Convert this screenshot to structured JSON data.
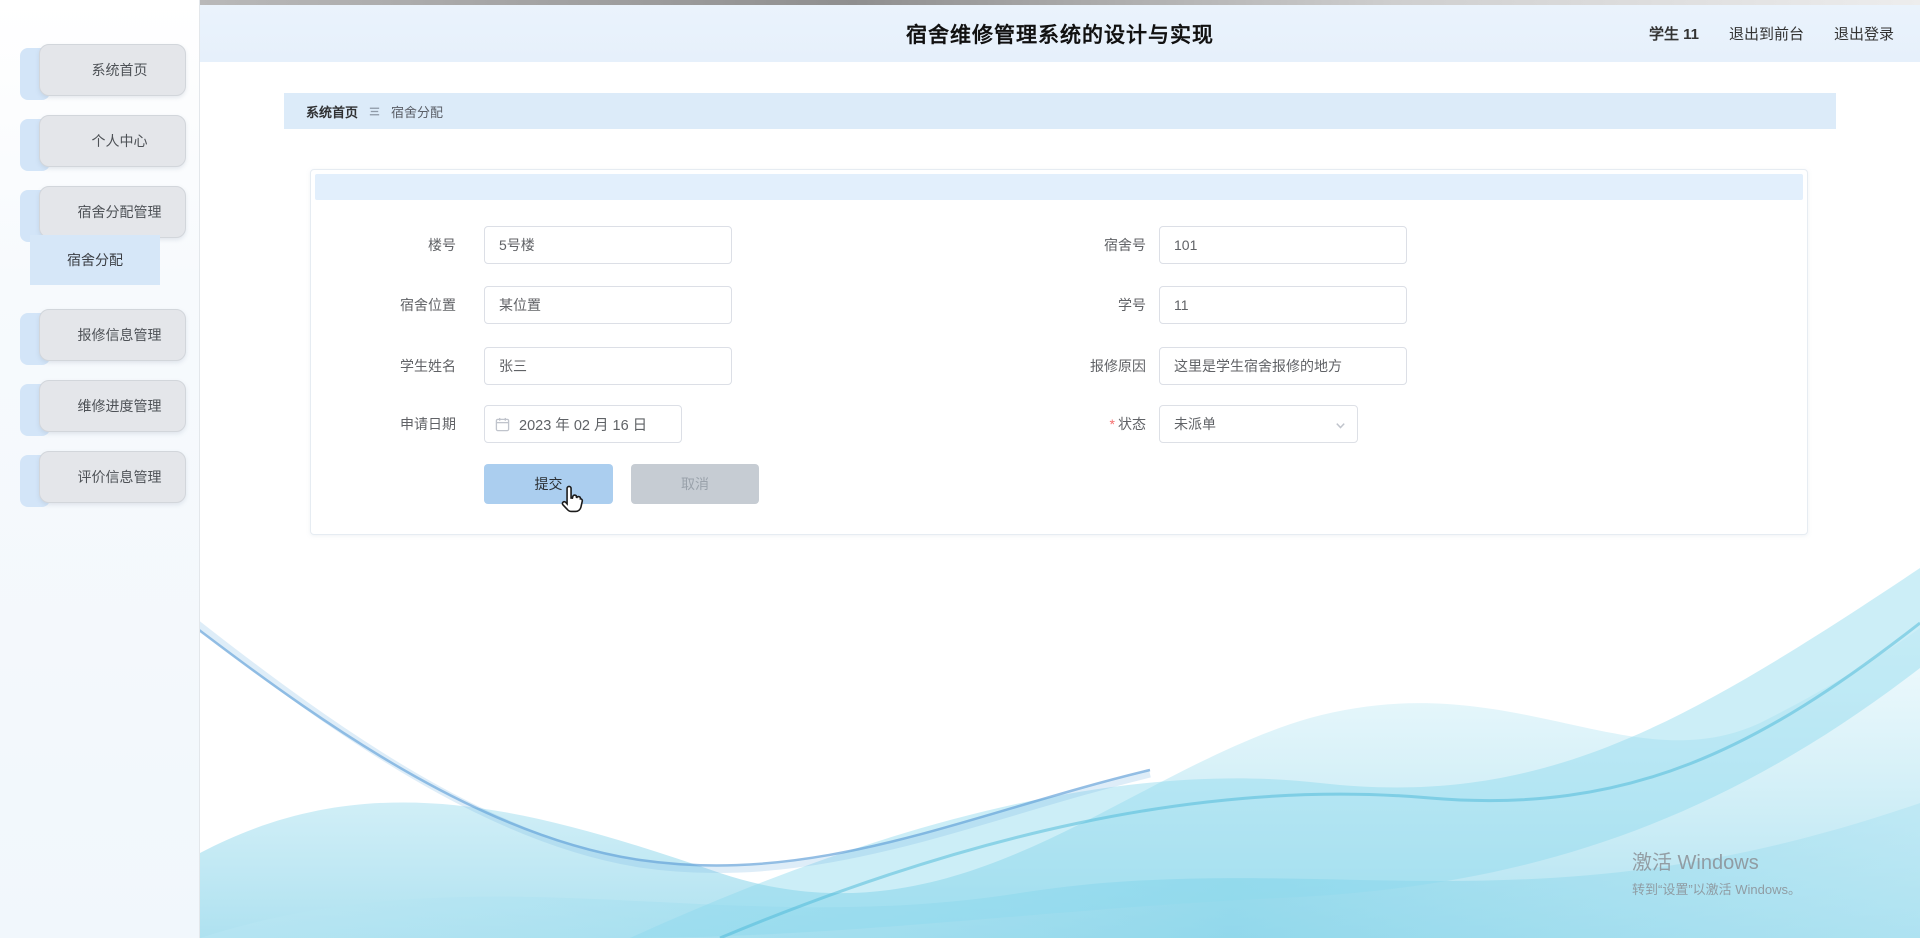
{
  "header": {
    "title": "宿舍维修管理系统的设计与实现",
    "user": "学生 11",
    "logout_front_label": "退出到前台",
    "logout_label": "退出登录"
  },
  "sidebar": {
    "items": [
      {
        "label": "系统首页"
      },
      {
        "label": "个人中心"
      },
      {
        "label": "宿舍分配管理"
      },
      {
        "label": "报修信息管理"
      },
      {
        "label": "维修进度管理"
      },
      {
        "label": "评价信息管理"
      }
    ],
    "submenu": {
      "label": "宿舍分配",
      "active": true
    }
  },
  "breadcrumb": {
    "home": "系统首页",
    "current": "宿舍分配"
  },
  "form": {
    "fields": [
      {
        "label": "楼号",
        "value": "5号楼"
      },
      {
        "label": "宿舍号",
        "value": "101"
      },
      {
        "label": "宿舍位置",
        "value": "某位置"
      },
      {
        "label": "学号",
        "value": "11"
      },
      {
        "label": "学生姓名",
        "value": "张三"
      },
      {
        "label": "报修原因",
        "value": "这里是学生宿舍报修的地方"
      },
      {
        "label": "申请日期",
        "value": "2023 年 02 月 16 日"
      },
      {
        "label": "状态",
        "value": "未派单",
        "required": "*"
      }
    ],
    "submit_label": "提交",
    "cancel_label": "取消"
  },
  "watermark": {
    "line1": "激活 Windows",
    "line2": "转到“设置”以激活 Windows。"
  },
  "colors": {
    "header_bg": "#e8f2fc",
    "breadcrumb_bg": "#dcebf9",
    "menu_btn_bg": "#e4e6ea",
    "menu_accent": "#d3e5f8",
    "submenu_active_bg": "#d6e7f8",
    "card_strip": "#e2effc",
    "submit_bg": "#abceef",
    "cancel_bg": "#c6ccd3",
    "required_star": "#f56c6c",
    "wave_cyan": "#6cc9e4",
    "wave_blue": "#5b9bd5"
  }
}
